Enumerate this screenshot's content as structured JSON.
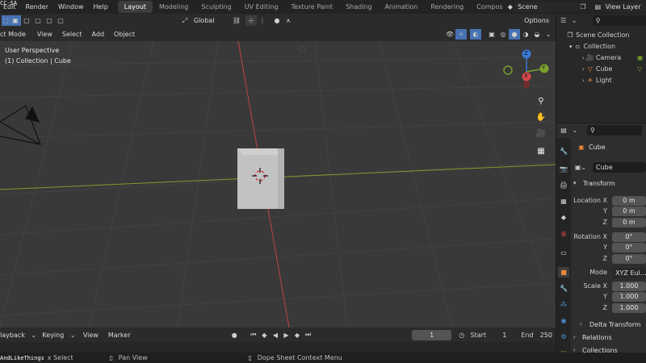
{
  "topbar": {
    "menus": [
      "Edit",
      "Render",
      "Window",
      "Help"
    ],
    "workspace_tabs": [
      "Layout",
      "Modeling",
      "Sculpting",
      "UV Editing",
      "Texture Paint",
      "Shading",
      "Animation",
      "Rendering",
      "Compos"
    ],
    "active_tab": "Layout",
    "scene": "Scene",
    "view_layer": "View Layer"
  },
  "viewport_header": {
    "transform_orientation": "Global",
    "options_label": "Options",
    "mode": "ct Mode",
    "menus": [
      "View",
      "Select",
      "Add",
      "Object"
    ]
  },
  "viewport": {
    "perspective": "User Perspective",
    "collection_info": "(1) Collection | Cube",
    "gizmo": {
      "z": "Z",
      "y": "Y",
      "x": "X"
    }
  },
  "outliner": {
    "root": "Scene Collection",
    "collection": "Collection",
    "items": [
      "Camera",
      "Cube",
      "Light"
    ]
  },
  "properties": {
    "object_name": "Cube",
    "data_name": "Cube",
    "panel_transform": "Transform",
    "location": {
      "label_x": "Location X",
      "label_y": "Y",
      "label_z": "Z",
      "x": "0 m",
      "y": "0 m",
      "z": "0 m"
    },
    "rotation": {
      "label_x": "Rotation X",
      "label_y": "Y",
      "label_z": "Z",
      "x": "0°",
      "y": "0°",
      "z": "0°"
    },
    "mode_label": "Mode",
    "mode_value": "XYZ Eul…",
    "scale": {
      "label_x": "Scale X",
      "label_y": "Y",
      "label_z": "Z",
      "x": "1.000",
      "y": "1.000",
      "z": "1.000"
    },
    "delta_transform": "Delta Transform",
    "relations": "Relations",
    "collections": "Collections"
  },
  "timeline": {
    "playback": "layback",
    "keying": "Keying",
    "view": "View",
    "marker": "Marker",
    "current_frame": "1",
    "start_label": "Start",
    "start_value": "1",
    "end_label": "End",
    "end_value": "250"
  },
  "statusbar": {
    "select": "x Select",
    "pan": "Pan View",
    "context": "Dope Sheet Context Menu"
  },
  "watermark": {
    "top_left": "CC-SA",
    "bottom_left": "AndLikeThings"
  },
  "colors": {
    "active_tab": "#3d3d3d",
    "viewport_bg": "#393939",
    "x_axis": "#d04848",
    "y_axis": "#7e9e2c",
    "z_gizmo": "#3b79d8",
    "y_gizmo": "#7aa12c",
    "x_gizmo": "#d04848",
    "selected_orange": "#e8873a"
  }
}
